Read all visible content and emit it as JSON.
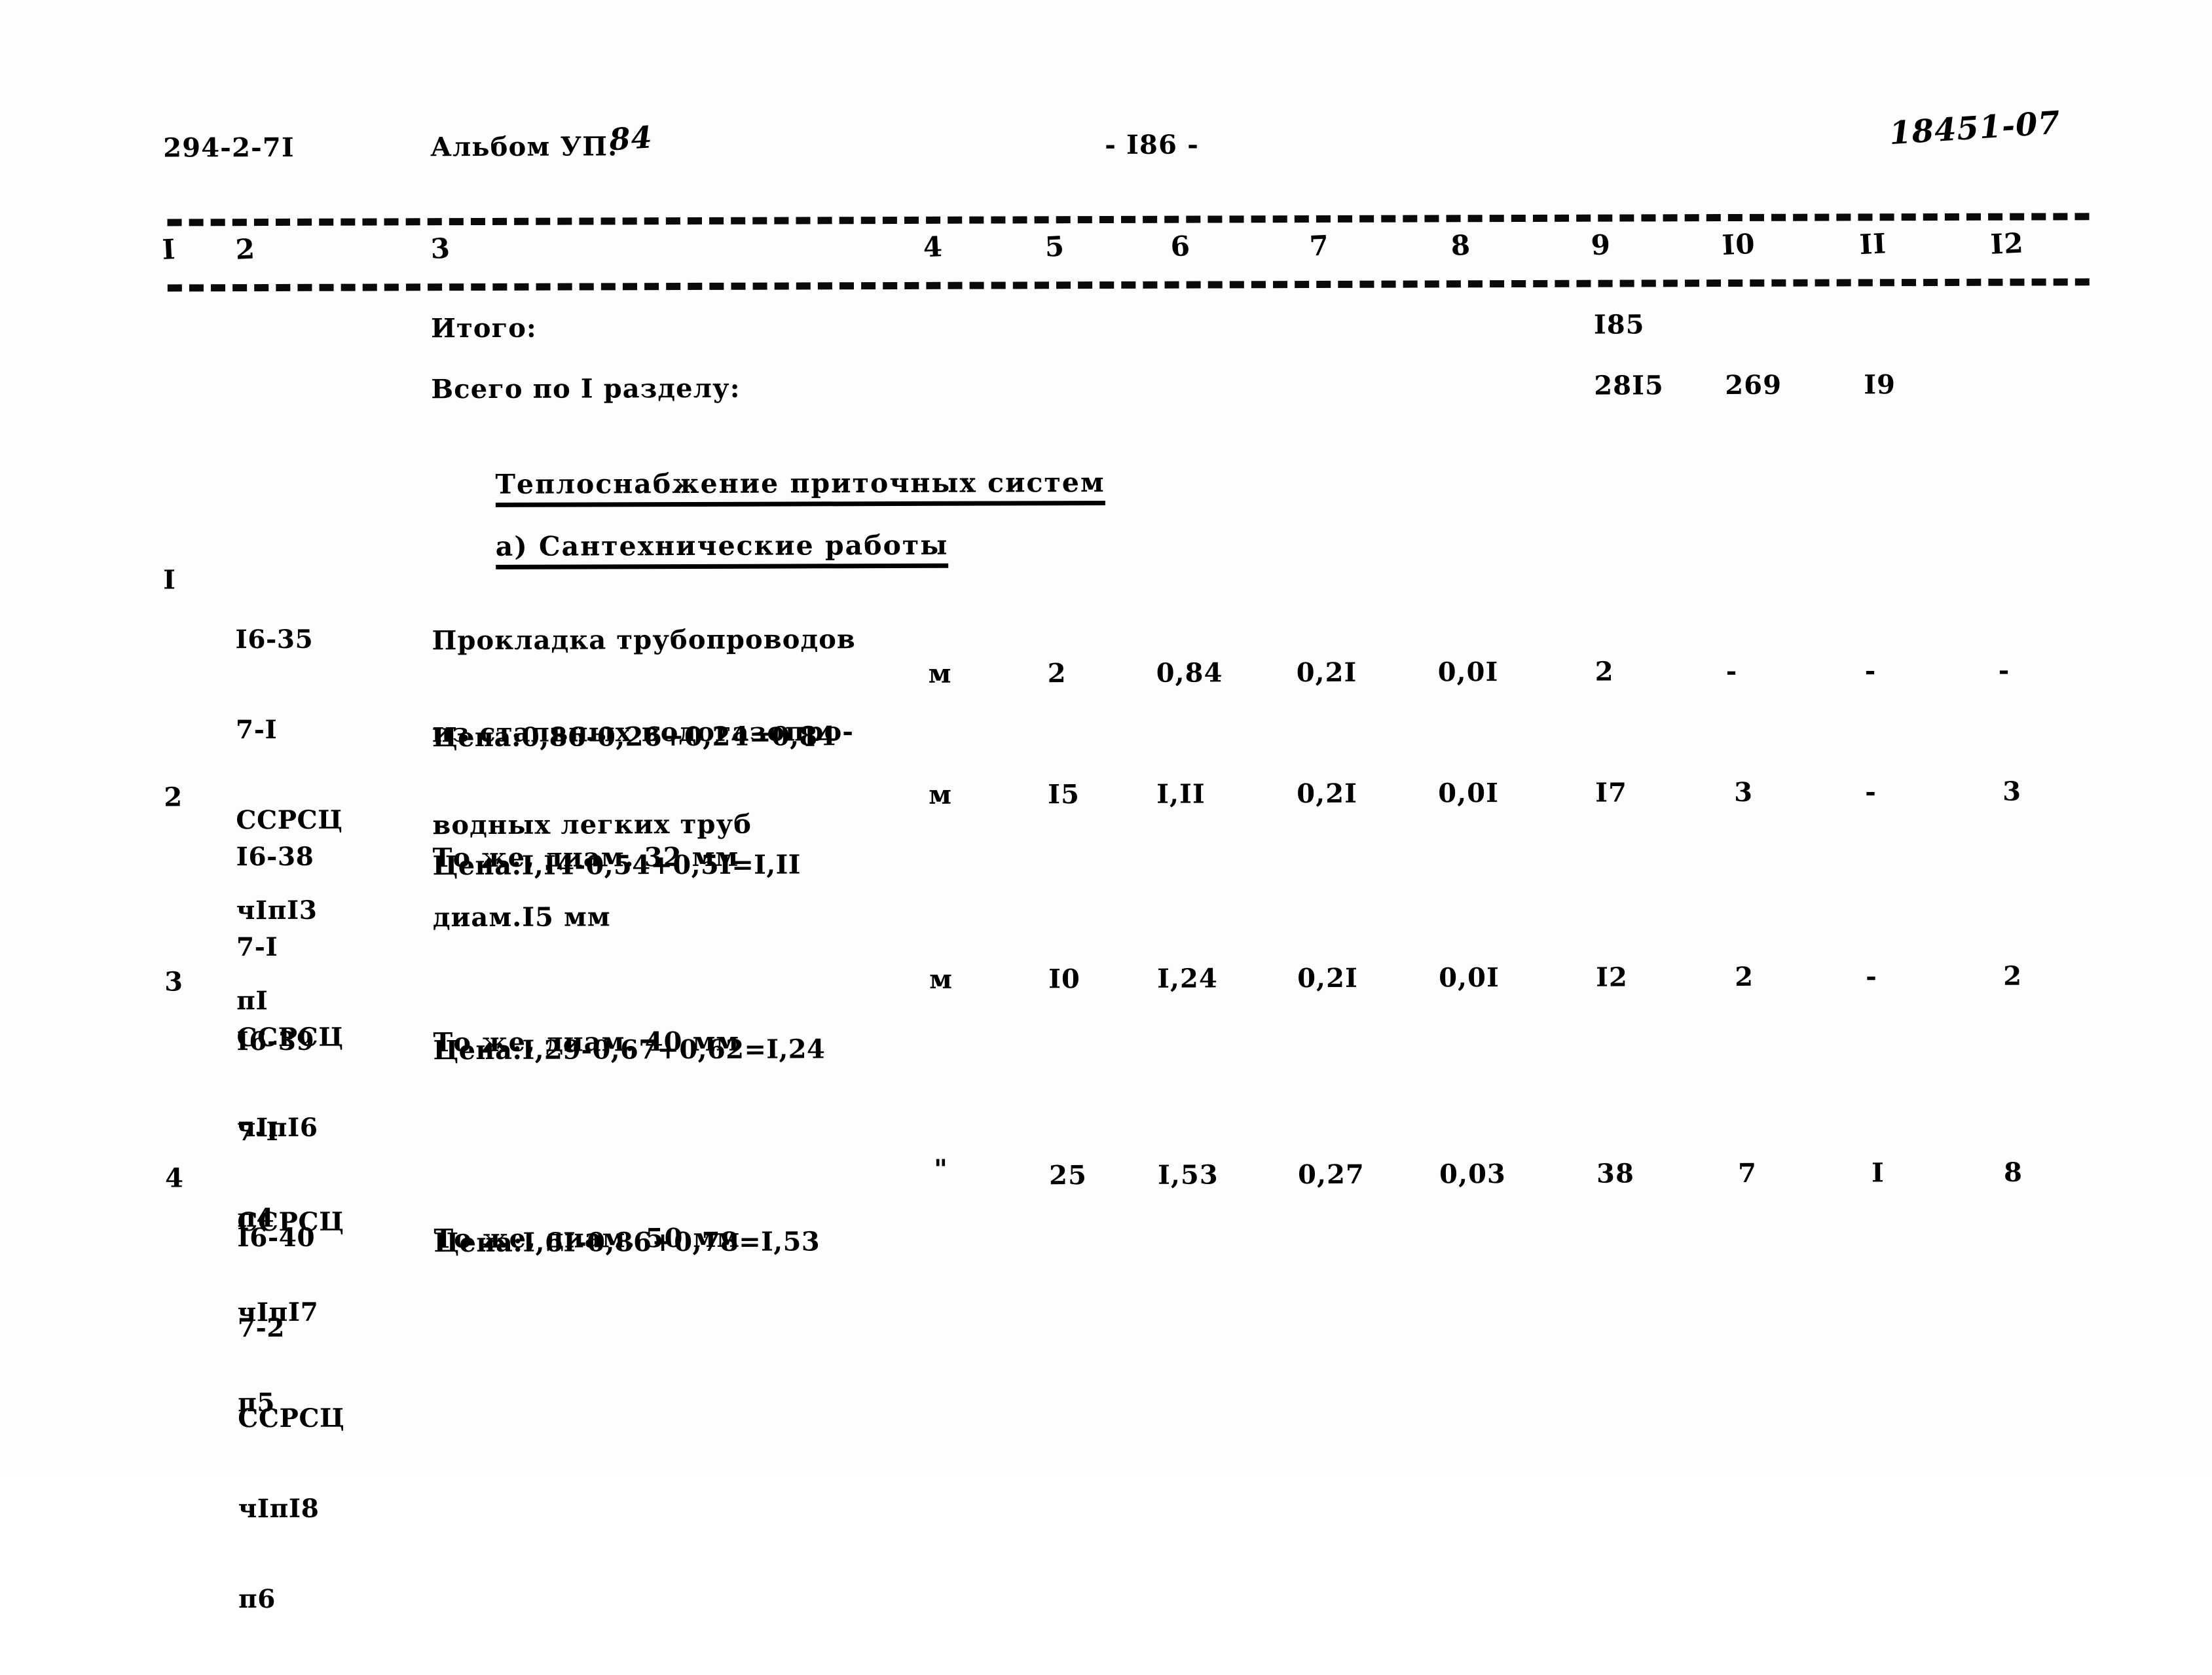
{
  "header": {
    "doc_code": "294-2-7I",
    "album_label": "Альбом УП.",
    "album_number": "84",
    "page_number": "- I86 -",
    "stamp_code": "18451-07"
  },
  "column_headers": [
    "I",
    "2",
    "3",
    "4",
    "5",
    "6",
    "7",
    "8",
    "9",
    "I0",
    "II",
    "I2"
  ],
  "summary_rows": [
    {
      "label": "Итого:",
      "c4": "",
      "c5": "",
      "c6": "",
      "c7": "",
      "c8": "",
      "c9": "I85",
      "c10": "",
      "c11": "",
      "c12": ""
    },
    {
      "label": "Всего по I разделу:",
      "c4": "",
      "c5": "",
      "c6": "",
      "c7": "",
      "c8": "",
      "c9": "28I5",
      "c10": "269",
      "c11": "I9",
      "c12": ""
    }
  ],
  "section_title": "Теплоснабжение приточных систем",
  "subsection_title": "а) Сантехнические работы",
  "items": [
    {
      "no": "I",
      "code_lines": [
        "I6-35",
        "7-I",
        "ССРСЦ",
        "чIпI3",
        "пI"
      ],
      "description_lines": [
        "Прокладка трубопроводов",
        "из стальных водогазопро-",
        "водных легких труб",
        "диам.I5 мм"
      ],
      "price_line": "Цена:0,86-0,26+0,24=0,84",
      "unit": "м",
      "c5": "2",
      "c6": "0,84",
      "c7": "0,2I",
      "c8": "0,0I",
      "c9": "2",
      "c10": "-",
      "c11": "-",
      "c12": "-"
    },
    {
      "no": "2",
      "code_lines": [
        "I6-38",
        "7-I",
        "ССРСЦ",
        "чIпI6",
        "п4"
      ],
      "description_lines": [
        "То же, диам. 32 мм"
      ],
      "price_line": "Цена:I,I4-0,54+0,5I=I,II",
      "unit": "м",
      "c5": "I5",
      "c6": "I,II",
      "c7": "0,2I",
      "c8": "0,0I",
      "c9": "I7",
      "c10": "3",
      "c11": "-",
      "c12": "3"
    },
    {
      "no": "3",
      "code_lines": [
        "I6-39",
        "7-I",
        "ССРСЦ",
        "чIпI7",
        "п5"
      ],
      "description_lines": [
        "То же, диам. 40 мм"
      ],
      "price_line": "Цена:I,29-0,67+0,62=I,24",
      "unit": "м",
      "c5": "I0",
      "c6": "I,24",
      "c7": "0,2I",
      "c8": "0,0I",
      "c9": "I2",
      "c10": "2",
      "c11": "-",
      "c12": "2"
    },
    {
      "no": "4",
      "code_lines": [
        "I6-40",
        "7-2",
        "ССРСЦ",
        "чIпI8",
        "п6"
      ],
      "description_lines": [
        "То же, диам. 50 мм"
      ],
      "price_line": "Цена:I,6I-0,86+0,78=I,53",
      "unit": "\"",
      "c5": "25",
      "c6": "I,53",
      "c7": "0,27",
      "c8": "0,03",
      "c9": "38",
      "c10": "7",
      "c11": "I",
      "c12": "8"
    }
  ]
}
